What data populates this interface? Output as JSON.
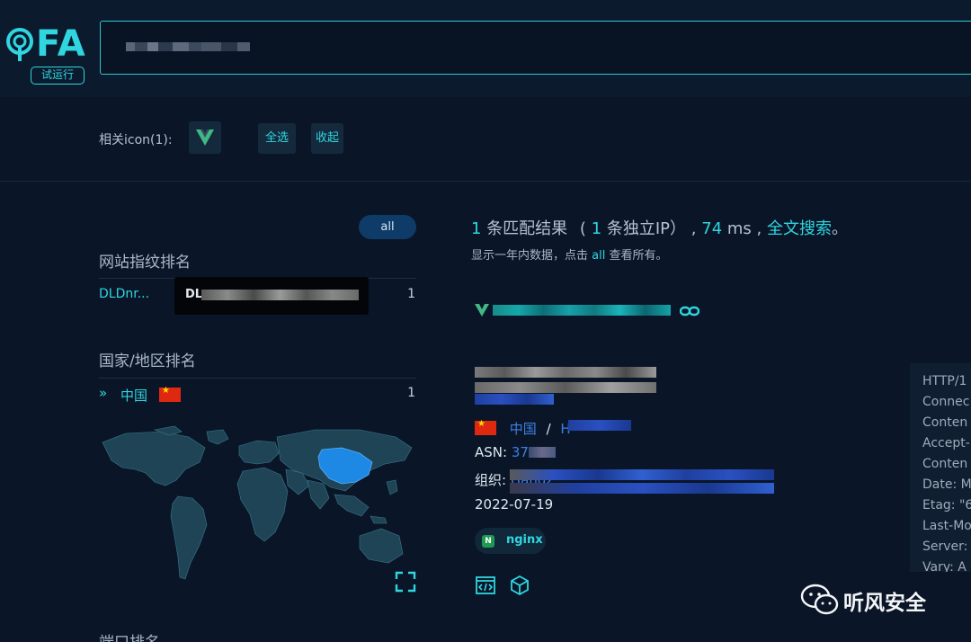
{
  "brand": {
    "logo_text": "FA",
    "badge": "试运行"
  },
  "filter": {
    "related_label": "相关icon(1):",
    "select_all": "全选",
    "collapse": "收起"
  },
  "sidebar": {
    "all_pill": "all",
    "fingerprint_title": "网站指纹排名",
    "fingerprint_items": [
      {
        "name": "DLDnr...",
        "count": "1",
        "tooltip_prefix": "DL"
      }
    ],
    "country_title": "国家/地区排名",
    "country_items": [
      {
        "name": "中国",
        "count": "1"
      }
    ],
    "port_title": "端口排名"
  },
  "results": {
    "count": "1",
    "match_label": "条匹配结果",
    "open_paren": "(",
    "ip_count": "1",
    "ip_label": "条独立IP）",
    "time_value": "74",
    "time_unit": "ms",
    "fulltext_link": "全文搜索",
    "period": "。",
    "sub_prefix": "显示一年内数据，点击",
    "sub_link": "all",
    "sub_suffix": "查看所有。"
  },
  "record": {
    "country": "中国",
    "region_sep": "/",
    "region_initial": "H",
    "asn_label": "ASN:",
    "asn_value": "37963",
    "org_label": "组织:",
    "org_value": "Hangz",
    "date": "2022-07-19",
    "server_tag": "nginx"
  },
  "http_headers": [
    "HTTP/1",
    "Connec",
    "Conten",
    "Accept-",
    "Conten",
    "Date: M",
    "Etag: \"6",
    "Last-Mo",
    "Server:",
    "Vary: A"
  ],
  "watermark": {
    "text": "听风安全"
  },
  "colors": {
    "accent": "#2fd6e0",
    "link": "#3d7fe6",
    "background": "#0a1628",
    "map_highlight": "#1e88e5"
  }
}
